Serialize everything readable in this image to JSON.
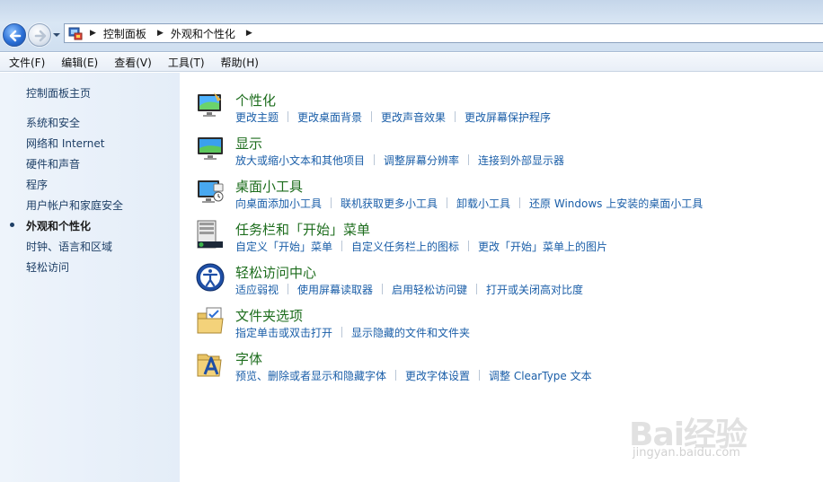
{
  "address_bar": {
    "breadcrumbs": [
      "控制面板",
      "外观和个性化"
    ]
  },
  "menu": {
    "items": [
      "文件(F)",
      "编辑(E)",
      "查看(V)",
      "工具(T)",
      "帮助(H)"
    ]
  },
  "sidebar": {
    "home": "控制面板主页",
    "items": [
      {
        "label": "系统和安全",
        "active": false
      },
      {
        "label": "网络和 Internet",
        "active": false
      },
      {
        "label": "硬件和声音",
        "active": false
      },
      {
        "label": "程序",
        "active": false
      },
      {
        "label": "用户帐户和家庭安全",
        "active": false
      },
      {
        "label": "外观和个性化",
        "active": true
      },
      {
        "label": "时钟、语言和区域",
        "active": false
      },
      {
        "label": "轻松访问",
        "active": false
      }
    ]
  },
  "sections": [
    {
      "title": "个性化",
      "icon": "personalization-icon",
      "links": [
        "更改主题",
        "更改桌面背景",
        "更改声音效果",
        "更改屏幕保护程序"
      ]
    },
    {
      "title": "显示",
      "icon": "display-icon",
      "links": [
        "放大或缩小文本和其他项目",
        "调整屏幕分辨率",
        "连接到外部显示器"
      ]
    },
    {
      "title": "桌面小工具",
      "icon": "gadgets-icon",
      "links": [
        "向桌面添加小工具",
        "联机获取更多小工具",
        "卸载小工具",
        "还原 Windows 上安装的桌面小工具"
      ]
    },
    {
      "title": "任务栏和「开始」菜单",
      "icon": "taskbar-icon",
      "links": [
        "自定义「开始」菜单",
        "自定义任务栏上的图标",
        "更改「开始」菜单上的图片"
      ]
    },
    {
      "title": "轻松访问中心",
      "icon": "ease-of-access-icon",
      "links": [
        "适应弱视",
        "使用屏幕读取器",
        "启用轻松访问键",
        "打开或关闭高对比度"
      ]
    },
    {
      "title": "文件夹选项",
      "icon": "folder-options-icon",
      "links": [
        "指定单击或双击打开",
        "显示隐藏的文件和文件夹"
      ]
    },
    {
      "title": "字体",
      "icon": "fonts-icon",
      "links": [
        "预览、删除或者显示和隐藏字体",
        "更改字体设置",
        "调整 ClearType 文本"
      ]
    }
  ],
  "watermark": {
    "brand": "Bai经验",
    "url": "jingyan.baidu.com"
  }
}
